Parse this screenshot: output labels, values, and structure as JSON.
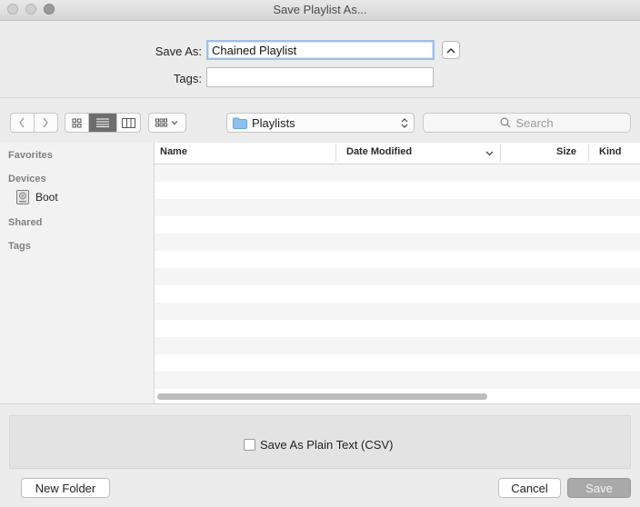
{
  "window": {
    "title": "Save Playlist As..."
  },
  "form": {
    "save_as_label": "Save As:",
    "save_as_value": "Chained Playlist",
    "tags_label": "Tags:",
    "tags_value": ""
  },
  "toolbar": {
    "location": "Playlists",
    "search_placeholder": "Search",
    "view_mode": "list",
    "icons": [
      "chevron-left-icon",
      "chevron-right-icon",
      "icon-view-icon",
      "list-view-icon",
      "column-view-icon",
      "arrange-icon",
      "folder-icon",
      "search-icon"
    ]
  },
  "sidebar": {
    "sections": [
      {
        "title": "Favorites",
        "items": []
      },
      {
        "title": "Devices",
        "items": [
          {
            "label": "Boot",
            "icon": "disk-icon"
          }
        ]
      },
      {
        "title": "Shared",
        "items": []
      },
      {
        "title": "Tags",
        "items": []
      }
    ]
  },
  "file_list": {
    "columns": [
      "Name",
      "Date Modified",
      "Size",
      "Kind"
    ],
    "rows": []
  },
  "accessory": {
    "checkbox_label": "Save As Plain Text (CSV)",
    "checked": false
  },
  "buttons": {
    "new_folder": "New Folder",
    "cancel": "Cancel",
    "save": "Save"
  },
  "colors": {
    "selected_segment": "#6d6d6d",
    "focus_ring": "#9fbfe6",
    "save_disabled": "#a9a9a9"
  }
}
